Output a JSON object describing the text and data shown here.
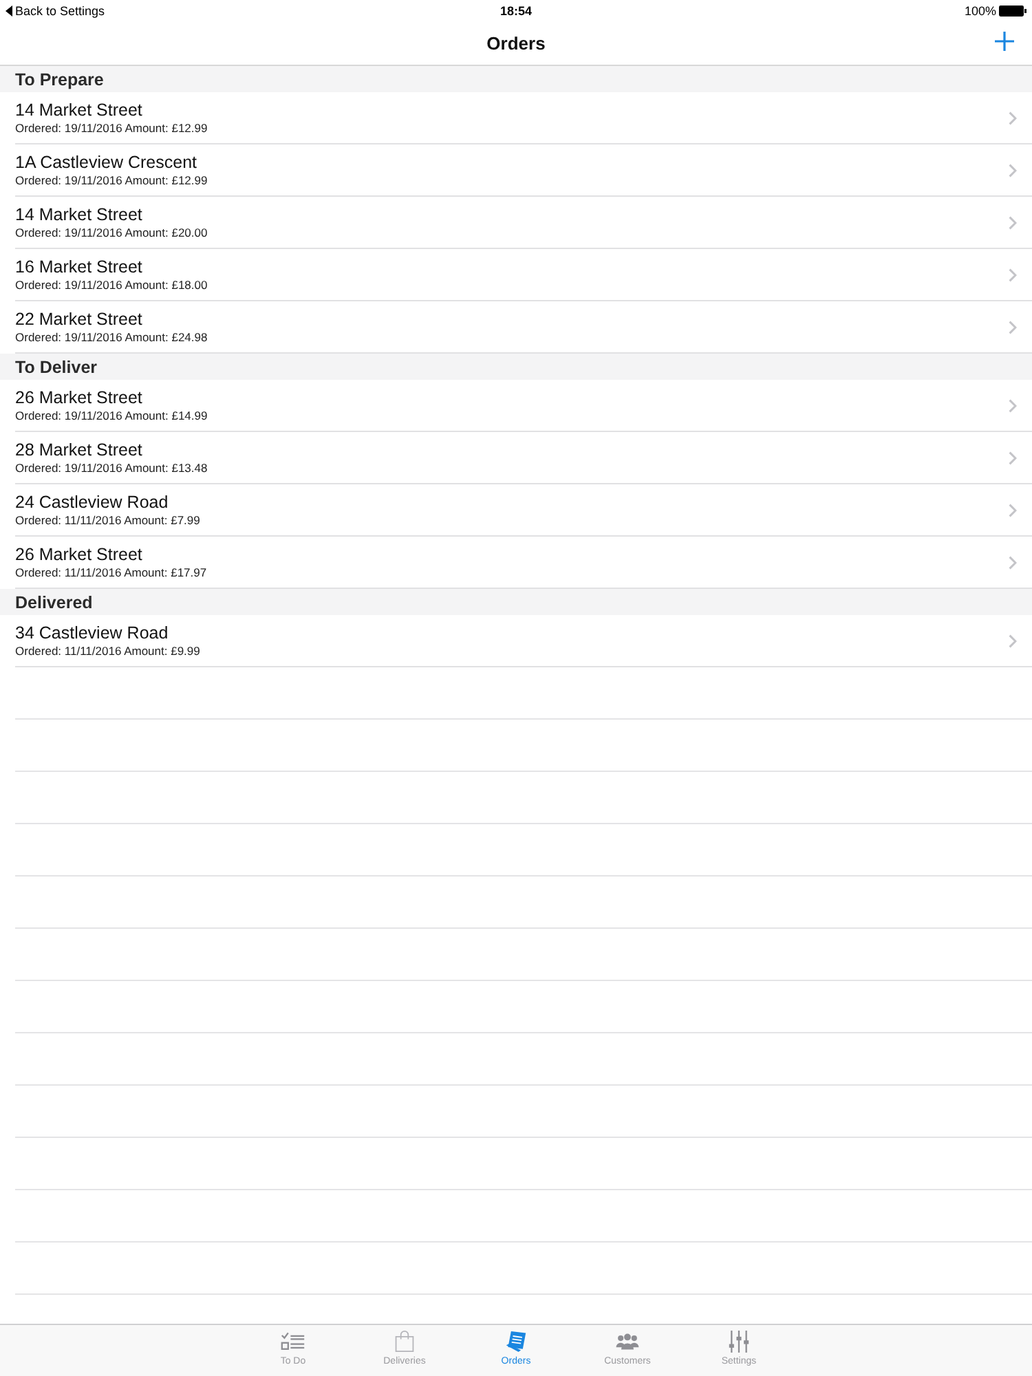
{
  "status_bar": {
    "back_label": "Back to Settings",
    "time": "18:54",
    "battery": "100%"
  },
  "nav_bar": {
    "title": "Orders"
  },
  "sections": [
    {
      "title": "To Prepare",
      "rows": [
        {
          "address": "14 Market Street",
          "detail": "Ordered: 19/11/2016 Amount: £12.99"
        },
        {
          "address": "1A Castleview Crescent",
          "detail": "Ordered: 19/11/2016 Amount: £12.99"
        },
        {
          "address": "14 Market Street",
          "detail": "Ordered: 19/11/2016 Amount: £20.00"
        },
        {
          "address": "16 Market Street",
          "detail": "Ordered: 19/11/2016 Amount: £18.00"
        },
        {
          "address": "22 Market Street",
          "detail": "Ordered: 19/11/2016 Amount: £24.98"
        }
      ]
    },
    {
      "title": "To Deliver",
      "rows": [
        {
          "address": "26 Market Street",
          "detail": "Ordered: 19/11/2016 Amount: £14.99"
        },
        {
          "address": "28 Market Street",
          "detail": "Ordered: 19/11/2016 Amount: £13.48"
        },
        {
          "address": "24 Castleview Road",
          "detail": "Ordered: 11/11/2016 Amount: £7.99"
        },
        {
          "address": "26 Market Street",
          "detail": "Ordered: 11/11/2016 Amount: £17.97"
        }
      ]
    },
    {
      "title": "Delivered",
      "rows": [
        {
          "address": "34 Castleview Road",
          "detail": "Ordered: 11/11/2016 Amount: £9.99"
        }
      ]
    }
  ],
  "tab_bar": {
    "tabs": [
      {
        "label": "To Do",
        "kind": "todo",
        "selected": false
      },
      {
        "label": "Deliveries",
        "kind": "deliveries",
        "selected": false
      },
      {
        "label": "Orders",
        "kind": "orders",
        "selected": true
      },
      {
        "label": "Customers",
        "kind": "customers",
        "selected": false
      },
      {
        "label": "Settings",
        "kind": "settings",
        "selected": false
      }
    ]
  }
}
